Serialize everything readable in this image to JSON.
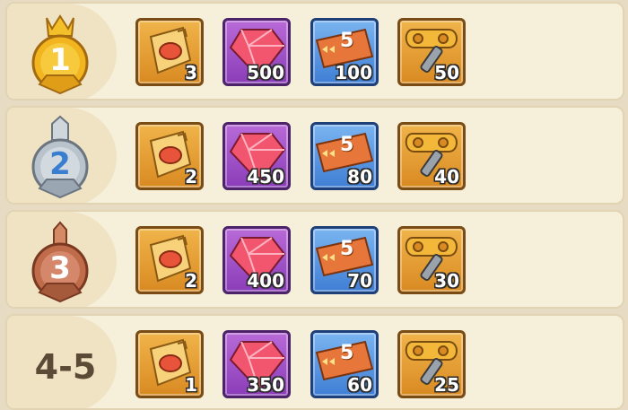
{
  "rows": [
    {
      "rank": "1",
      "medal": "gold-crown-medal",
      "medal_color": "#f2b51f",
      "rewards": [
        {
          "icon": "coupon-book-icon",
          "qty": "3"
        },
        {
          "icon": "ruby-gem-icon",
          "qty": "500"
        },
        {
          "icon": "speedup-ticket-icon",
          "qty": "100"
        },
        {
          "icon": "windup-key-icon",
          "qty": "50"
        }
      ]
    },
    {
      "rank": "2",
      "medal": "silver-medal",
      "medal_color": "#b9c3cc",
      "rewards": [
        {
          "icon": "coupon-book-icon",
          "qty": "2"
        },
        {
          "icon": "ruby-gem-icon",
          "qty": "450"
        },
        {
          "icon": "speedup-ticket-icon",
          "qty": "80"
        },
        {
          "icon": "windup-key-icon",
          "qty": "40"
        }
      ]
    },
    {
      "rank": "3",
      "medal": "bronze-medal",
      "medal_color": "#c06b4a",
      "rewards": [
        {
          "icon": "coupon-book-icon",
          "qty": "2"
        },
        {
          "icon": "ruby-gem-icon",
          "qty": "400"
        },
        {
          "icon": "speedup-ticket-icon",
          "qty": "70"
        },
        {
          "icon": "windup-key-icon",
          "qty": "30"
        }
      ]
    },
    {
      "rank": "4-5",
      "rewards": [
        {
          "icon": "coupon-book-icon",
          "qty": "1"
        },
        {
          "icon": "ruby-gem-icon",
          "qty": "350"
        },
        {
          "icon": "speedup-ticket-icon",
          "qty": "60"
        },
        {
          "icon": "windup-key-icon",
          "qty": "25"
        }
      ]
    }
  ],
  "ticket_text": "5"
}
